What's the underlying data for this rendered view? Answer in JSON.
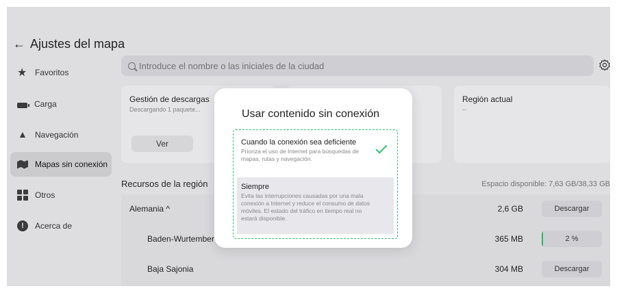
{
  "header": {
    "title": "Ajustes del mapa"
  },
  "sidebar": {
    "items": [
      {
        "label": "Favoritos",
        "icon": "star-icon"
      },
      {
        "label": "Carga",
        "icon": "battery-icon"
      },
      {
        "label": "Navegación",
        "icon": "navigation-icon"
      },
      {
        "label": "Mapas sin conexión",
        "icon": "offline-map-icon",
        "active": true
      },
      {
        "label": "Otros",
        "icon": "grid-icon"
      },
      {
        "label": "Acerca de",
        "icon": "info-icon"
      }
    ]
  },
  "search": {
    "placeholder": "Introduce el nombre o las iniciales de la ciudad"
  },
  "cards": {
    "downloads": {
      "title": "Gestión de descargas",
      "subtitle": "Descargando 1 paquete...",
      "button": "Ver"
    },
    "region": {
      "title": "Región actual",
      "value": "--"
    }
  },
  "resources": {
    "title": "Recursos de la región",
    "space": "Espacio disponible: 7,63 GB/38,33 GB",
    "rows": [
      {
        "name": "Alemania ^",
        "size": "2,6 GB",
        "action": "Descargar"
      },
      {
        "name": "Baden-Wurtember",
        "size": "365 MB",
        "progress": "2 %",
        "progress_value": 0.02
      },
      {
        "name": "Baja Sajonia",
        "size": "304 MB",
        "action": "Descargar"
      }
    ]
  },
  "dialog": {
    "title": "Usar contenido sin conexión",
    "options": [
      {
        "title": "Cuando la conexión sea deficiente",
        "desc": "Prioriza el uso de Internet para búsquedas de mapas, rutas y navegación.",
        "selected": true
      },
      {
        "title": "Siempre",
        "desc": "Evita las interrupciones causadas por una mala conexión a Internet y reduce el consumo de datos móviles. El estado del tráfico en tiempo real no estará disponible.",
        "selected": false
      }
    ]
  },
  "colors": {
    "accent": "#2ec46e",
    "background": "#ececef",
    "card": "#f5f5f7"
  }
}
